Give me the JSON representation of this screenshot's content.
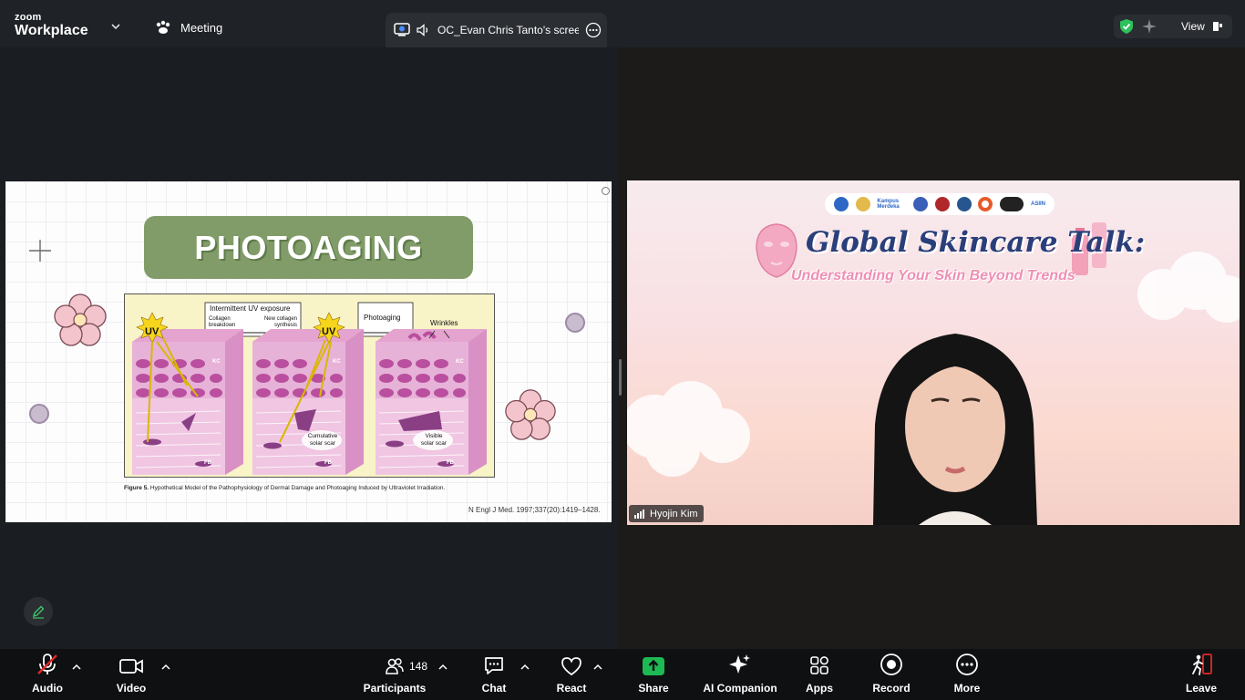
{
  "app": {
    "brand_small": "zoom",
    "brand_large": "Workplace",
    "meeting_label": "Meeting"
  },
  "share_tab": {
    "label": "OC_Evan Chris Tanto's screer"
  },
  "top_right": {
    "view_label": "View"
  },
  "slide": {
    "title": "PHOTOAGING",
    "figure": {
      "intermittent_label": "Intermittent UV exposure",
      "collagen_breakdown": "Collagen breakdown",
      "new_collagen": "New collagen synthesis",
      "photoaging_label": "Photoaging",
      "wrinkles_label": "Wrinkles",
      "uv_label_1": "UV",
      "uv_label_2": "UV",
      "kc_1": "KC",
      "kc_2": "KC",
      "kc_3": "KC",
      "fb_1": "FB",
      "fb_2": "FB",
      "fb_3": "FB",
      "cumulative_scar_1": "Cumulative",
      "cumulative_scar_2": "solar scar",
      "visible_scar_1": "Visible",
      "visible_scar_2": "solar scar"
    },
    "caption_bold": "Figure 5.",
    "caption_text": " Hypothetical Model of the Pathophysiology of Dermal Damage and Photoaging Induced by Ultraviolet Irradiation.",
    "citation": "N Engl J Med. 1997;337(20):1419–1428."
  },
  "video": {
    "banner_title": "Global Skincare Talk:",
    "banner_subtitle": "Understanding Your Skin Beyond Trends",
    "logo_text_kampus": "Kampus Merdeka",
    "logo_text_asiin": "ASIIN",
    "participant_name": "Hyojin Kim"
  },
  "toolbar": {
    "audio": "Audio",
    "video": "Video",
    "participants": "Participants",
    "participants_count": "148",
    "chat": "Chat",
    "react": "React",
    "share": "Share",
    "ai_companion": "AI Companion",
    "apps": "Apps",
    "record": "Record",
    "more": "More",
    "leave": "Leave"
  },
  "colors": {
    "slide_title_bg": "#819c68",
    "share_green": "#1db954",
    "leave_red": "#e02828",
    "audio_muted_red": "#e02828"
  }
}
